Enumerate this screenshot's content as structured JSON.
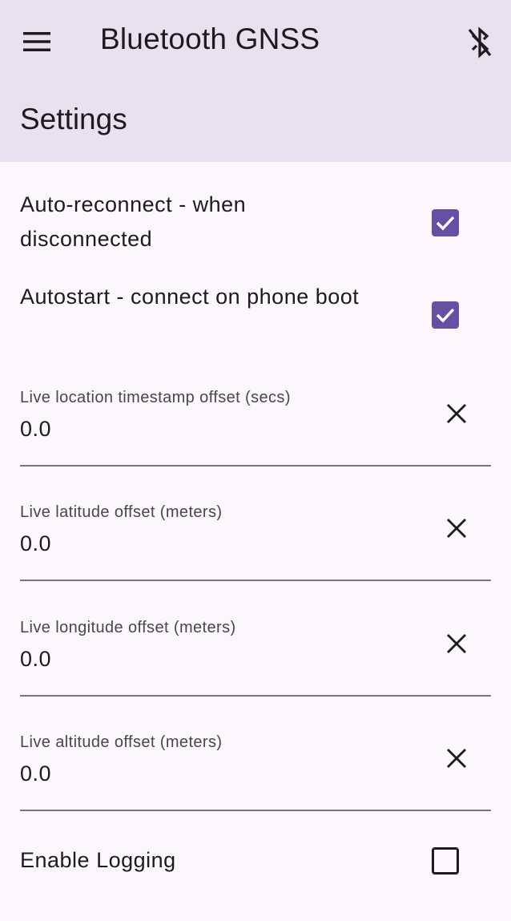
{
  "app_bar": {
    "title": "Bluetooth GNSS",
    "menu_icon": "menu-icon",
    "bluetooth_icon": "bluetooth-disabled-icon"
  },
  "page": {
    "subtitle": "Settings"
  },
  "settings": {
    "auto_reconnect": {
      "label": "Auto-reconnect - when disconnected",
      "checked": true
    },
    "autostart": {
      "label": "Autostart - connect on phone boot",
      "checked": true
    },
    "fields": [
      {
        "label": "Live location timestamp offset (secs)",
        "value": "0.0"
      },
      {
        "label": "Live latitude offset (meters)",
        "value": "0.0"
      },
      {
        "label": "Live longitude offset (meters)",
        "value": "0.0"
      },
      {
        "label": "Live altitude offset (meters)",
        "value": "0.0"
      }
    ],
    "enable_logging": {
      "label": "Enable Logging",
      "checked": false
    }
  },
  "colors": {
    "app_bar_bg": "#e8e1ef",
    "page_bg": "#fdf7fd",
    "accent": "#6750a4",
    "text": "#1d1b20",
    "label_text": "#49454f",
    "underline": "#79747e"
  }
}
